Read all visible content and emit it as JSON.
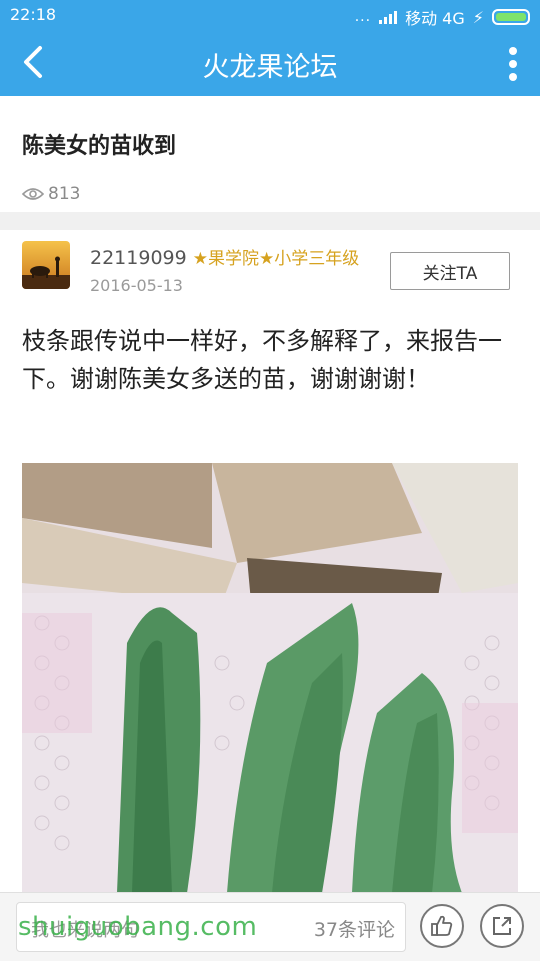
{
  "status_bar": {
    "time": "22:18",
    "dots": "...",
    "carrier": "移动 4G",
    "colors": {
      "bar": "#3aa6e8",
      "battery": "#7ee36b"
    }
  },
  "header": {
    "title": "火龙果论坛",
    "back_icon": "chevron-left-icon",
    "more_icon": "more-vertical-icon"
  },
  "post": {
    "title": "陈美女的苗收到",
    "views": "813",
    "author": {
      "name": "22119099",
      "rank": "★果学院★小学三年级",
      "date": "2016-05-13",
      "follow_label": "关注TA"
    },
    "body": "枝条跟传说中一样好，不多解释了，来报告一下。谢谢陈美女多送的苗，谢谢谢谢！"
  },
  "bottom_bar": {
    "comment_placeholder": "我也来说两句",
    "comment_count": "37条评论",
    "like_icon": "thumbs-up-icon",
    "share_icon": "share-icon"
  },
  "watermark": "shuiguobang.com"
}
